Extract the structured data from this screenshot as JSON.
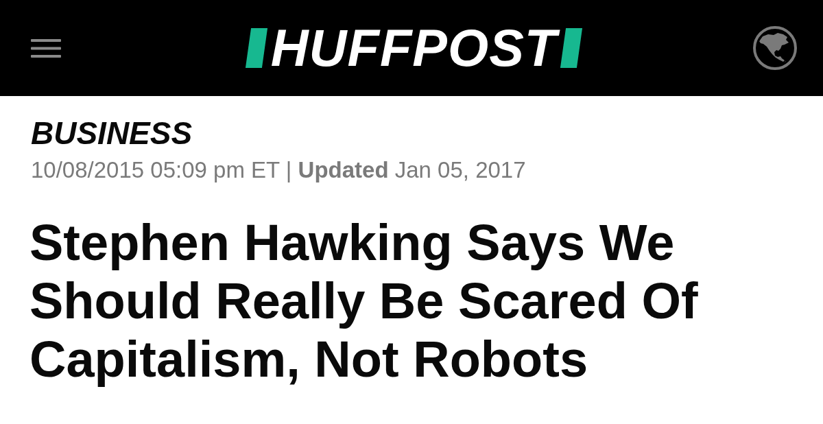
{
  "header": {
    "logo": "HUFFPOST"
  },
  "article": {
    "section": "BUSINESS",
    "meta": "10/08/2015 05:09 pm ET | **Updated** Jan 05, 2017",
    "headline": "Stephen Hawking Says We Should Really Be Scared Of Capitalism, Not Robots"
  }
}
